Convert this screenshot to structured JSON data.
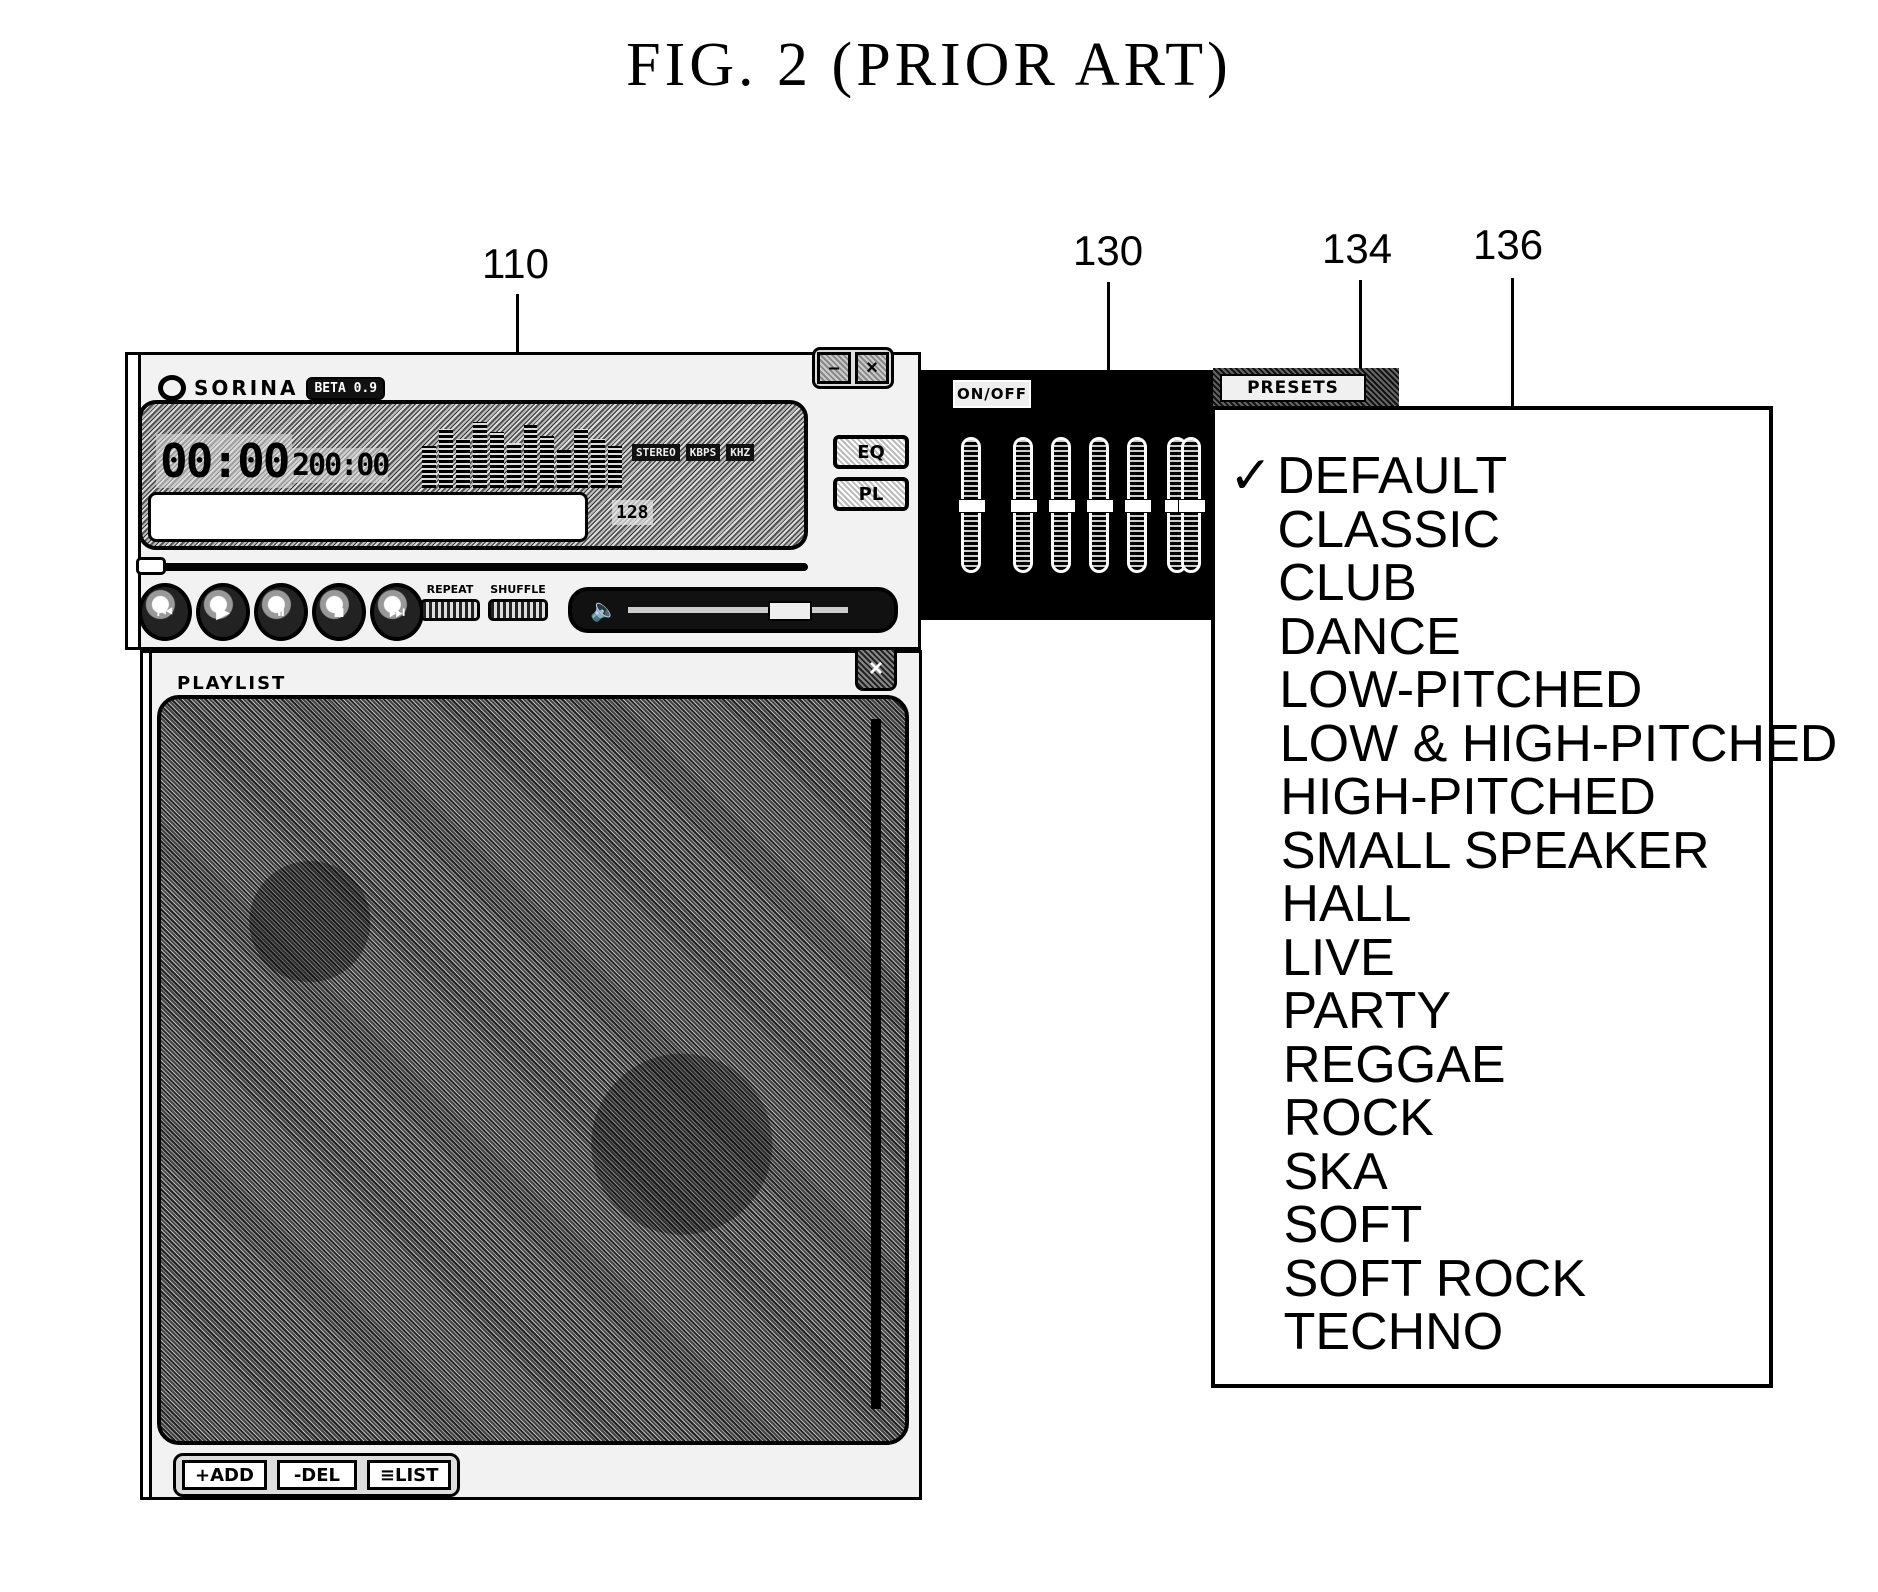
{
  "figure": {
    "title": "FIG. 2 (PRIOR ART)",
    "reference_numerals": {
      "player": "110",
      "equalizer": "130",
      "presets_button": "134",
      "presets_menu": "136"
    }
  },
  "player": {
    "app_name": "SORINA",
    "version_badge": "BETA 0.9",
    "title_buttons": {
      "minimize": "–",
      "close": "×"
    },
    "display": {
      "elapsed_time": "00:00",
      "total_time": "200:00",
      "info_tags": [
        "STEREO",
        "KBPS",
        "KHZ"
      ],
      "bitrate": "128",
      "song_title": ""
    },
    "side_buttons": {
      "eq": "EQ",
      "playlist": "PL"
    },
    "transport": [
      {
        "name": "previous",
        "glyph": "⏮"
      },
      {
        "name": "play",
        "glyph": "▶"
      },
      {
        "name": "pause",
        "glyph": "⏸"
      },
      {
        "name": "stop",
        "glyph": "■"
      },
      {
        "name": "next",
        "glyph": "⏭"
      }
    ],
    "toggles": {
      "repeat": "REPEAT",
      "shuffle": "SHUFFLE"
    },
    "volume_icon": "🔈"
  },
  "playlist": {
    "title": "PLAYLIST",
    "close": "×",
    "buttons": {
      "add": "+ADD",
      "del": "-DEL",
      "list": "≡LIST"
    }
  },
  "equalizer": {
    "onoff_label": "ON/OFF",
    "presets_label": "PRESETS",
    "band_levels": [
      0.5,
      0.5,
      0.5,
      0.5,
      0.5,
      0.5,
      0.5
    ]
  },
  "presets_menu": {
    "selected": "DEFAULT",
    "check_glyph": "✓",
    "items": [
      "DEFAULT",
      "CLASSIC",
      "CLUB",
      "DANCE",
      "LOW-PITCHED",
      "LOW & HIGH-PITCHED",
      "HIGH-PITCHED",
      "SMALL SPEAKER",
      "HALL",
      "LIVE",
      "PARTY",
      "REGGAE",
      "ROCK",
      "SKA",
      "SOFT",
      "SOFT ROCK",
      "TECHNO"
    ]
  }
}
